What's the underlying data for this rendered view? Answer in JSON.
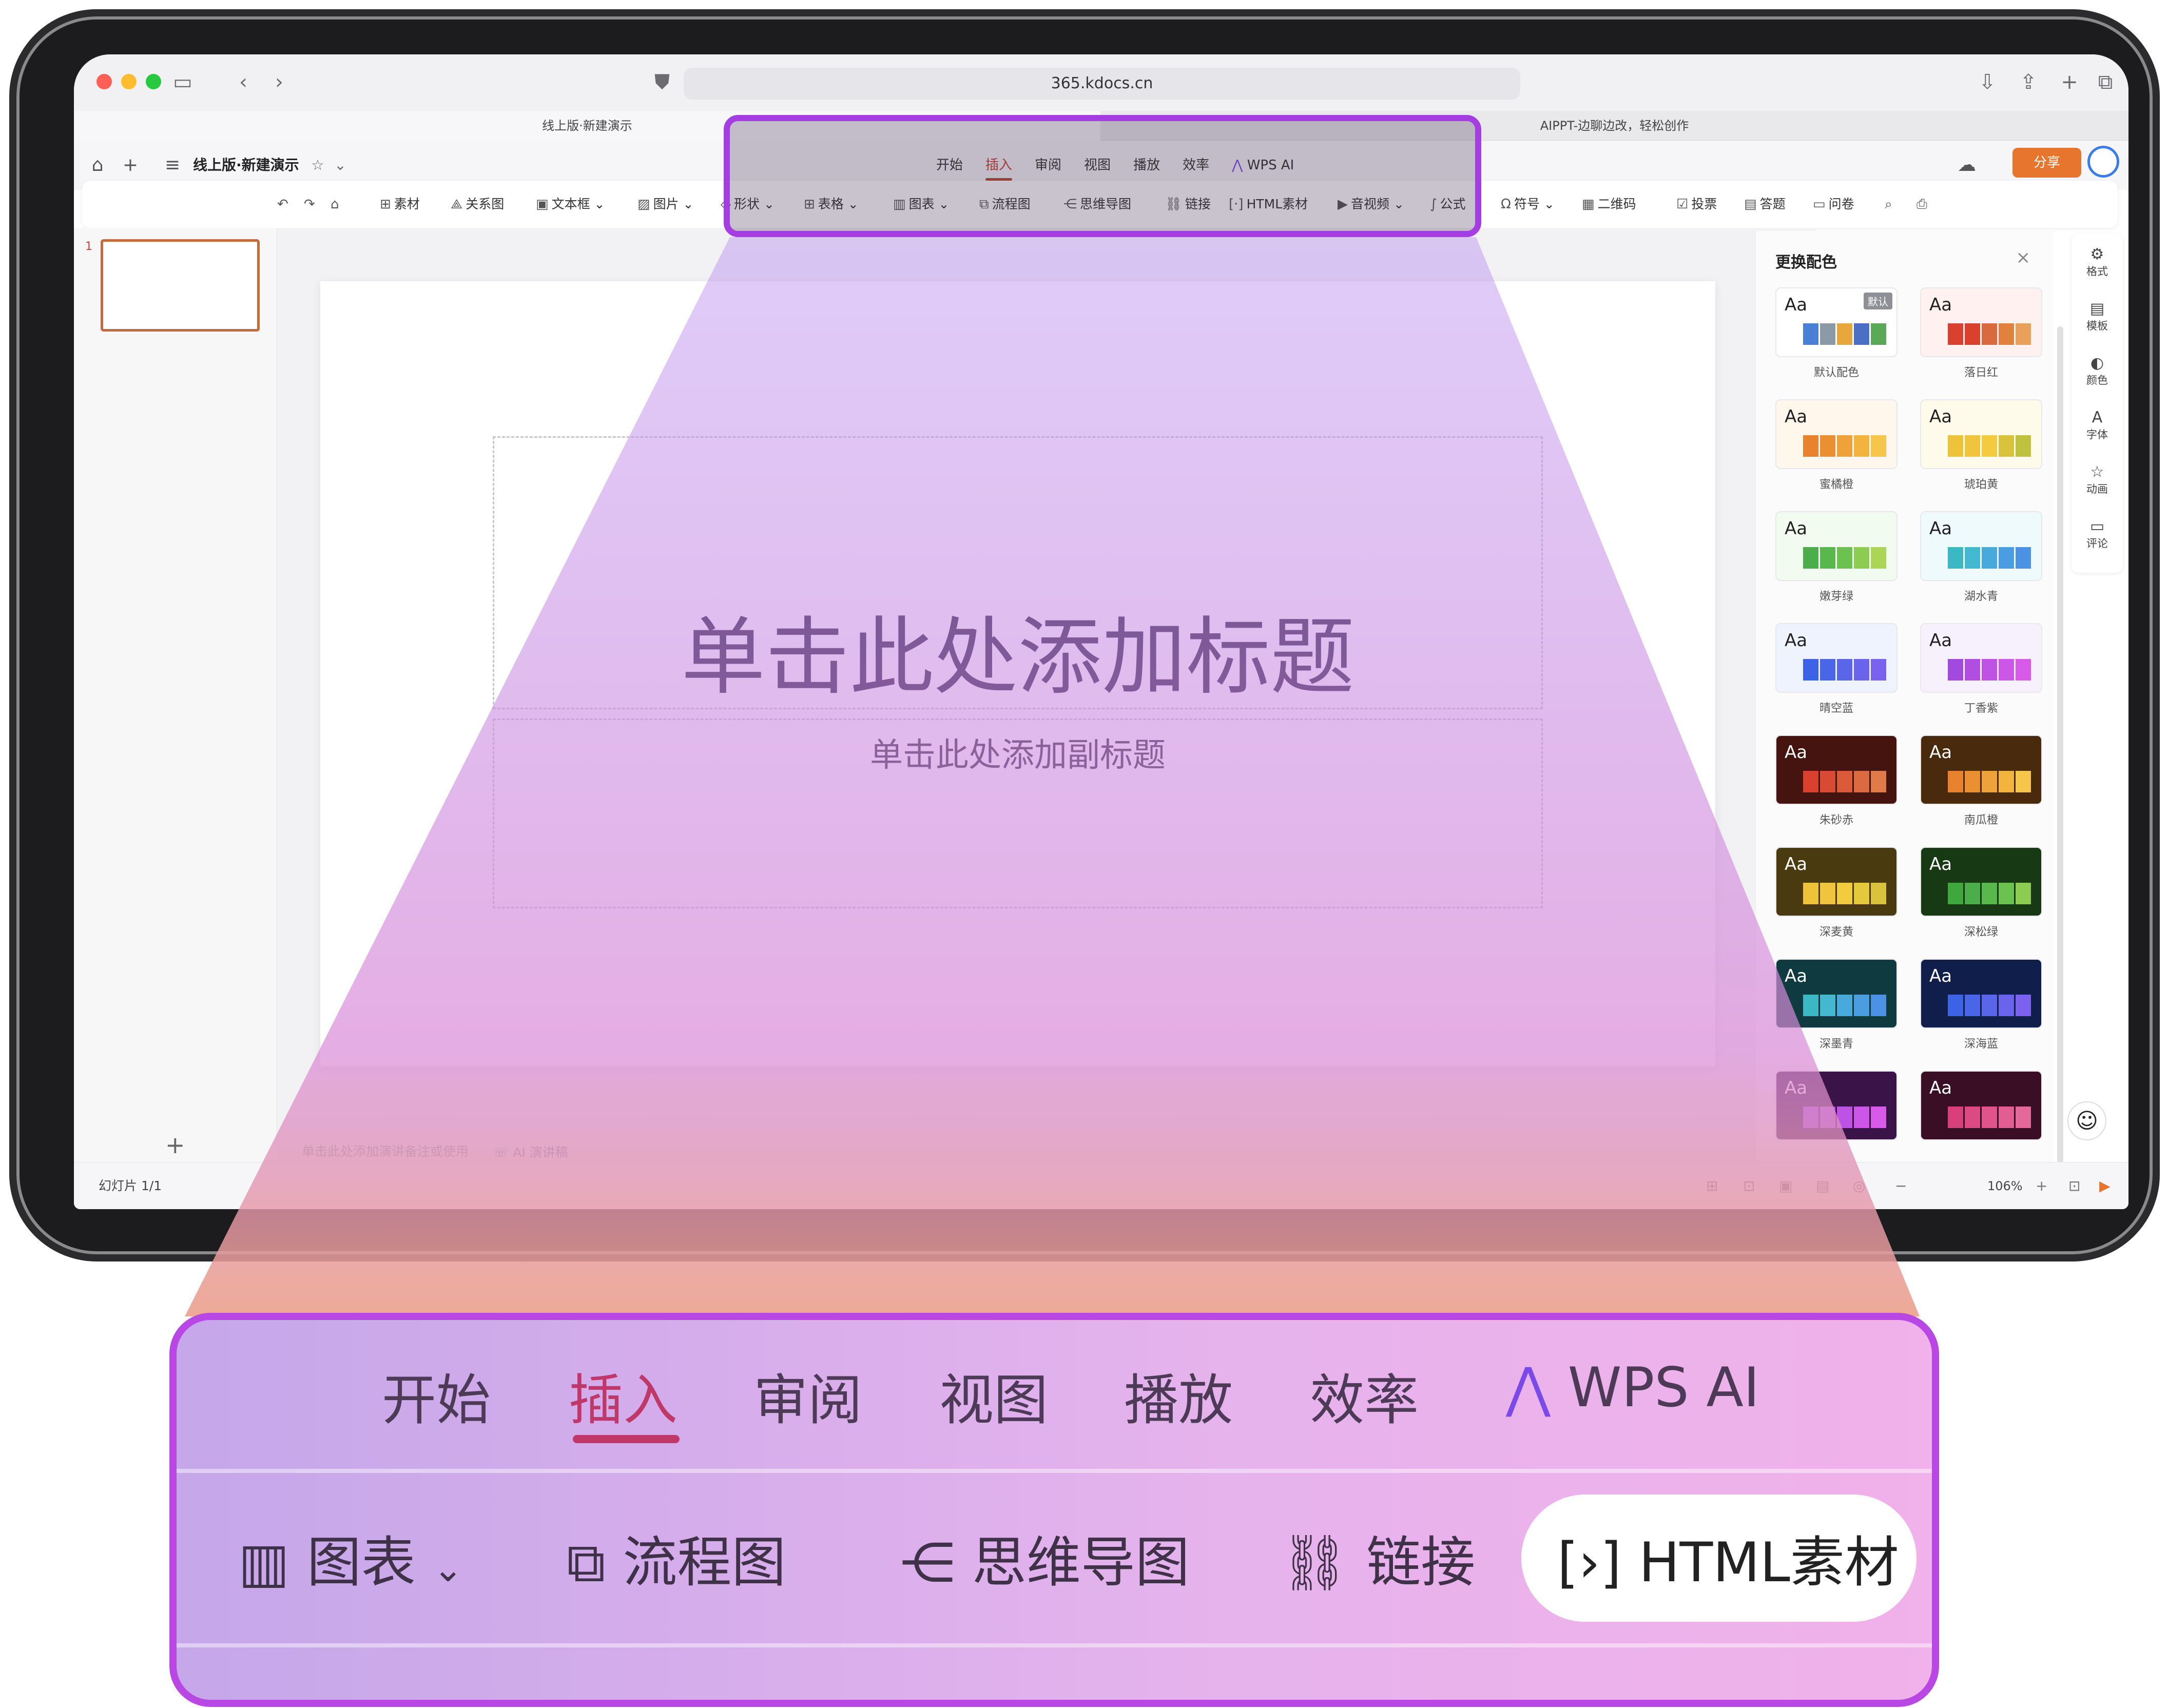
{
  "browser": {
    "url": "365.kdocs.cn",
    "tabs": [
      "线上版·新建演示",
      "AIPPT-边聊边改，轻松创作"
    ]
  },
  "app": {
    "doc_title": "线上版·新建演示",
    "share_label": "分享",
    "ribbon_tabs": [
      "开始",
      "插入",
      "审阅",
      "视图",
      "播放",
      "效率",
      "WPS AI"
    ],
    "active_tab": "插入"
  },
  "toolbar": {
    "items": [
      "素材",
      "关系图",
      "文本框",
      "图片",
      "形状",
      "表格",
      "图表",
      "流程图",
      "思维导图",
      "链接",
      "HTML素材",
      "音视频",
      "公式",
      "符号",
      "二维码",
      "投票",
      "答题",
      "问卷"
    ]
  },
  "slides": {
    "thumb_number": "1",
    "title_placeholder": "单击此处添加标题",
    "subtitle_placeholder": "单击此处添加副标题",
    "notes_placeholder": "单击此处添加演讲备注或使用",
    "ai_notes": "AI 演讲稿"
  },
  "color_panel": {
    "title": "更换配色",
    "aa": "Aa",
    "default_badge": "默认",
    "schemes": [
      {
        "name": "默认配色",
        "bg": "#ffffff",
        "text": "#222222",
        "bars": [
          "#4a7fd6",
          "#8c9aa8",
          "#e8a73d",
          "#4a6fc4",
          "#5aa957"
        ]
      },
      {
        "name": "落日红",
        "bg": "#fff1ef",
        "text": "#222222",
        "bars": [
          "#d9402e",
          "#d9402e",
          "#d96a3e",
          "#e0813e",
          "#e8a05a"
        ]
      },
      {
        "name": "蜜橘橙",
        "bg": "#fff6ec",
        "text": "#222222",
        "bars": [
          "#e8822e",
          "#ea8f32",
          "#f0a23a",
          "#f2b43e",
          "#f5c64a"
        ]
      },
      {
        "name": "琥珀黄",
        "bg": "#fffbea",
        "text": "#222222",
        "bars": [
          "#eec33a",
          "#f0c43c",
          "#f2cb3e",
          "#d9c23c",
          "#bfc23e"
        ]
      },
      {
        "name": "嫩芽绿",
        "bg": "#f2fbef",
        "text": "#222222",
        "bars": [
          "#4cae4a",
          "#58b84c",
          "#6cc24e",
          "#8ccc52",
          "#aad556"
        ]
      },
      {
        "name": "湖水青",
        "bg": "#eefafc",
        "text": "#222222",
        "bars": [
          "#3cb7c4",
          "#44b8d0",
          "#48a9dc",
          "#4a9de0",
          "#4c92e4"
        ]
      },
      {
        "name": "晴空蓝",
        "bg": "#eff3fd",
        "text": "#222222",
        "bars": [
          "#3c62e6",
          "#4a66e8",
          "#5a66ea",
          "#6a64ec",
          "#7a62ee"
        ]
      },
      {
        "name": "丁香紫",
        "bg": "#f7f0fd",
        "text": "#222222",
        "bars": [
          "#a24ae0",
          "#b04ee2",
          "#be52e4",
          "#cc56e6",
          "#d85ae8"
        ]
      },
      {
        "name": "朱砂赤",
        "bg": "#45140f",
        "text": "#ffffff",
        "bars": [
          "#d9402e",
          "#d94a34",
          "#da5a3a",
          "#dc6a40",
          "#e07a48"
        ]
      },
      {
        "name": "南瓜橙",
        "bg": "#4a2a0d",
        "text": "#ffffff",
        "bars": [
          "#e8822e",
          "#ea8f32",
          "#f0a23a",
          "#f2b43e",
          "#f5c64a"
        ]
      },
      {
        "name": "深麦黄",
        "bg": "#4a3a10",
        "text": "#ffffff",
        "bars": [
          "#eec33a",
          "#f0c43c",
          "#f2cb3e",
          "#e4c93c",
          "#d9c23c"
        ]
      },
      {
        "name": "深松绿",
        "bg": "#173a14",
        "text": "#ffffff",
        "bars": [
          "#3ea83c",
          "#4cae4a",
          "#58b84c",
          "#6cc24e",
          "#8ccc52"
        ]
      },
      {
        "name": "深墨青",
        "bg": "#0f3a40",
        "text": "#ffffff",
        "bars": [
          "#3cb7c4",
          "#44b8d0",
          "#48a9dc",
          "#4a9de0",
          "#4c92e4"
        ]
      },
      {
        "name": "深海蓝",
        "bg": "#0f1e4a",
        "text": "#ffffff",
        "bars": [
          "#3c62e6",
          "#4a66e8",
          "#5a66ea",
          "#6a64ec",
          "#7a62ee"
        ]
      },
      {
        "name": "",
        "bg": "#3a1348",
        "text": "#ffffff",
        "bars": [
          "#a24ae0",
          "#b04ee2",
          "#be52e4",
          "#cc56e6",
          "#d85ae8"
        ]
      },
      {
        "name": "",
        "bg": "#3a0f25",
        "text": "#ffffff",
        "bars": [
          "#d9407a",
          "#dc4a82",
          "#e0548a",
          "#e25e92",
          "#e4689a"
        ]
      }
    ]
  },
  "right_rail": [
    "格式",
    "模板",
    "颜色",
    "字体",
    "动画",
    "评论"
  ],
  "status": {
    "slide_count": "幻灯片 1/1",
    "zoom": "106%"
  },
  "callout": {
    "tabs": [
      "开始",
      "插入",
      "审阅",
      "视图",
      "播放",
      "效率",
      "WPS AI"
    ],
    "tools": [
      "图表",
      "流程图",
      "思维导图",
      "链接",
      "HTML素材"
    ]
  }
}
